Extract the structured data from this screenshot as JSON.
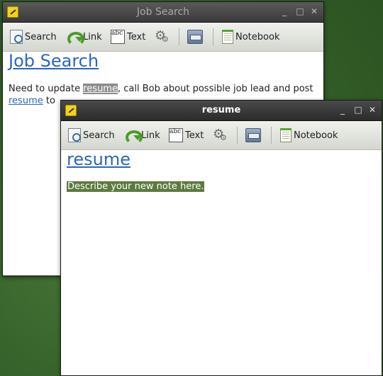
{
  "toolbar": {
    "search": "Search",
    "link": "Link",
    "text": "Text",
    "notebook": "Notebook",
    "text_icon_glyphs": "abc"
  },
  "back_window": {
    "title": "Job Search",
    "note_title": "Job Search",
    "body": {
      "part1": "Need to update ",
      "link1": "resume",
      "part2": ", call Bob about possible job lead and post",
      "link2": "resume",
      "part3": " to"
    }
  },
  "front_window": {
    "title": "resume",
    "note_title": "resume",
    "placeholder_text": "Describe your new note here."
  },
  "window_controls": {
    "minimize": "_",
    "maximize": "□",
    "close": "✕"
  },
  "colors": {
    "desktop": "#3d6b2c",
    "link": "#2a66bf",
    "selection_green": "#5c7a3e"
  }
}
